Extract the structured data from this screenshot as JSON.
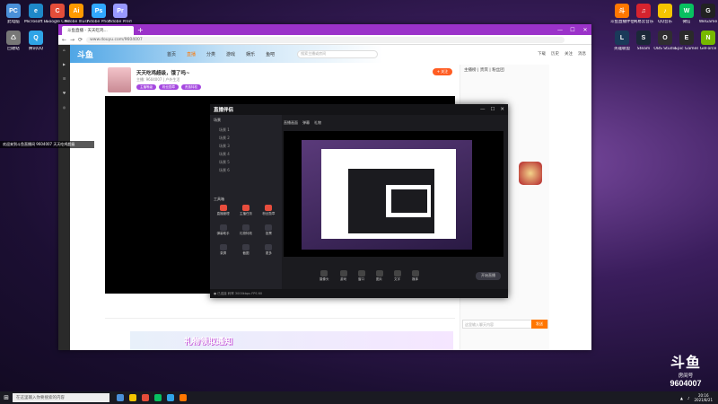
{
  "desktop": {
    "left_icons": [
      {
        "label": "此电脑",
        "color": "#4a90d9",
        "glyph": "PC"
      },
      {
        "label": "Microsoft Edge",
        "color": "#1e88c8",
        "glyph": "e"
      },
      {
        "label": "Google Chrome",
        "color": "#e44d3a",
        "glyph": "C"
      },
      {
        "label": "回收站",
        "color": "#777",
        "glyph": "♺"
      },
      {
        "label": "腾讯QQ",
        "color": "#2fa4e7",
        "glyph": "Q"
      },
      {
        "label": "Adobe Illustrator",
        "color": "#ff9a00",
        "glyph": "Ai"
      },
      {
        "label": "Adobe Photoshop",
        "color": "#31a8ff",
        "glyph": "Ps"
      },
      {
        "label": "Adobe Premiere",
        "color": "#9999ff",
        "glyph": "Pr"
      }
    ],
    "right_icons": [
      {
        "label": "斗鱼直播伴侣",
        "color": "#ff7700",
        "glyph": "斗"
      },
      {
        "label": "网易云音乐",
        "color": "#d6232e",
        "glyph": "♫"
      },
      {
        "label": "QQ音乐",
        "color": "#f5c400",
        "glyph": "♪"
      },
      {
        "label": "微信",
        "color": "#07c160",
        "glyph": "W"
      },
      {
        "label": "WeGame",
        "color": "#222",
        "glyph": "G"
      },
      {
        "label": "英雄联盟",
        "color": "#1a3a5a",
        "glyph": "L"
      },
      {
        "label": "Steam",
        "color": "#1b2838",
        "glyph": "S"
      },
      {
        "label": "OBS Studio",
        "color": "#302e31",
        "glyph": "O"
      },
      {
        "label": "Epic Games",
        "color": "#2a2a2a",
        "glyph": "E"
      },
      {
        "label": "GeForce",
        "color": "#76b900",
        "glyph": "N"
      }
    ]
  },
  "browser": {
    "tab_title": "斗鱼直播 - 天天吃鸡...",
    "url": "www.douyu.com/9604007"
  },
  "douyu": {
    "logo": "斗鱼",
    "nav": [
      "首页",
      "直播",
      "分类",
      "游戏",
      "娱乐",
      "鱼吧"
    ],
    "search_placeholder": "搜索主播或房间",
    "user": [
      "下载",
      "历史",
      "关注",
      "消息"
    ],
    "room_title": "天天吃鸡超级，饿了吗~",
    "room_meta": "主播: 9604007  |  户外生活",
    "badges": [
      "主播等级",
      "粉丝勋章",
      "贵族特权"
    ],
    "follow": "+ 关注",
    "gift_banner": "礼物领取通知",
    "chat_tabs": "主播榜 | 贵宾 | 粉丝团",
    "chat_placeholder": "这里输入聊天内容",
    "send": "发送"
  },
  "app": {
    "title": "直播伴侣",
    "tabs": [
      "直播画面",
      "弹幕",
      "礼物"
    ],
    "section": "场景",
    "scenes": [
      "场景 1",
      "场景 2",
      "场景 3",
      "场景 4",
      "场景 5",
      "场景 6"
    ],
    "tools_title": "工具箱",
    "tools": [
      "直播管理",
      "主播任务",
      "粉丝勋章",
      "弹幕助手",
      "礼物特效",
      "投票",
      "录屏",
      "截图",
      "更多"
    ],
    "bottom": [
      "摄像头",
      "游戏",
      "窗口",
      "图片",
      "文字",
      "媒体"
    ],
    "start": "开始直播",
    "status": "● 已连接  码率 3000kbps  FPS 60"
  },
  "left_tip": "欢迎来到斗鱼直播间 9604007 天天吃鸡超级",
  "watermark": {
    "logo": "斗鱼",
    "room_label": "房间号",
    "room_number": "9604007"
  },
  "taskbar": {
    "search": "在这里输入你要搜索的内容",
    "time": "20:16",
    "date": "2021/8/21"
  }
}
